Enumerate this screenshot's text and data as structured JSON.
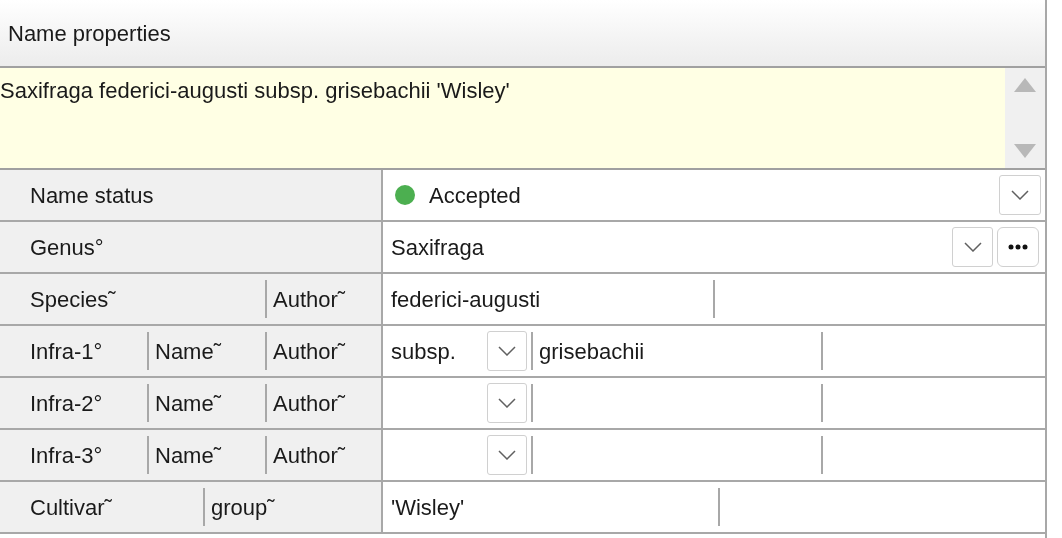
{
  "panel_title": "Name properties",
  "full_name": "Saxifraga federici-augusti subsp. grisebachii 'Wisley'",
  "rows": [
    {
      "kind": "status",
      "labels": [
        "Name status"
      ],
      "value": "Accepted",
      "color": "#4caf50"
    },
    {
      "kind": "genus",
      "labels": [
        "Genus°"
      ],
      "value": "Saxifraga"
    },
    {
      "kind": "species",
      "labels": [
        "Species˜",
        "Author˜"
      ],
      "value": "federici-augusti"
    },
    {
      "kind": "infra",
      "labels": [
        "Infra-1°",
        "Name˜",
        "Author˜"
      ],
      "rank": "subsp.",
      "value": "grisebachii"
    },
    {
      "kind": "infra",
      "labels": [
        "Infra-2°",
        "Name˜",
        "Author˜"
      ]
    },
    {
      "kind": "infra",
      "labels": [
        "Infra-3°",
        "Name˜",
        "Author˜"
      ]
    },
    {
      "kind": "cultivar",
      "labels": [
        "Cultivar˜",
        "group˜"
      ],
      "value": "'Wisley'"
    }
  ]
}
